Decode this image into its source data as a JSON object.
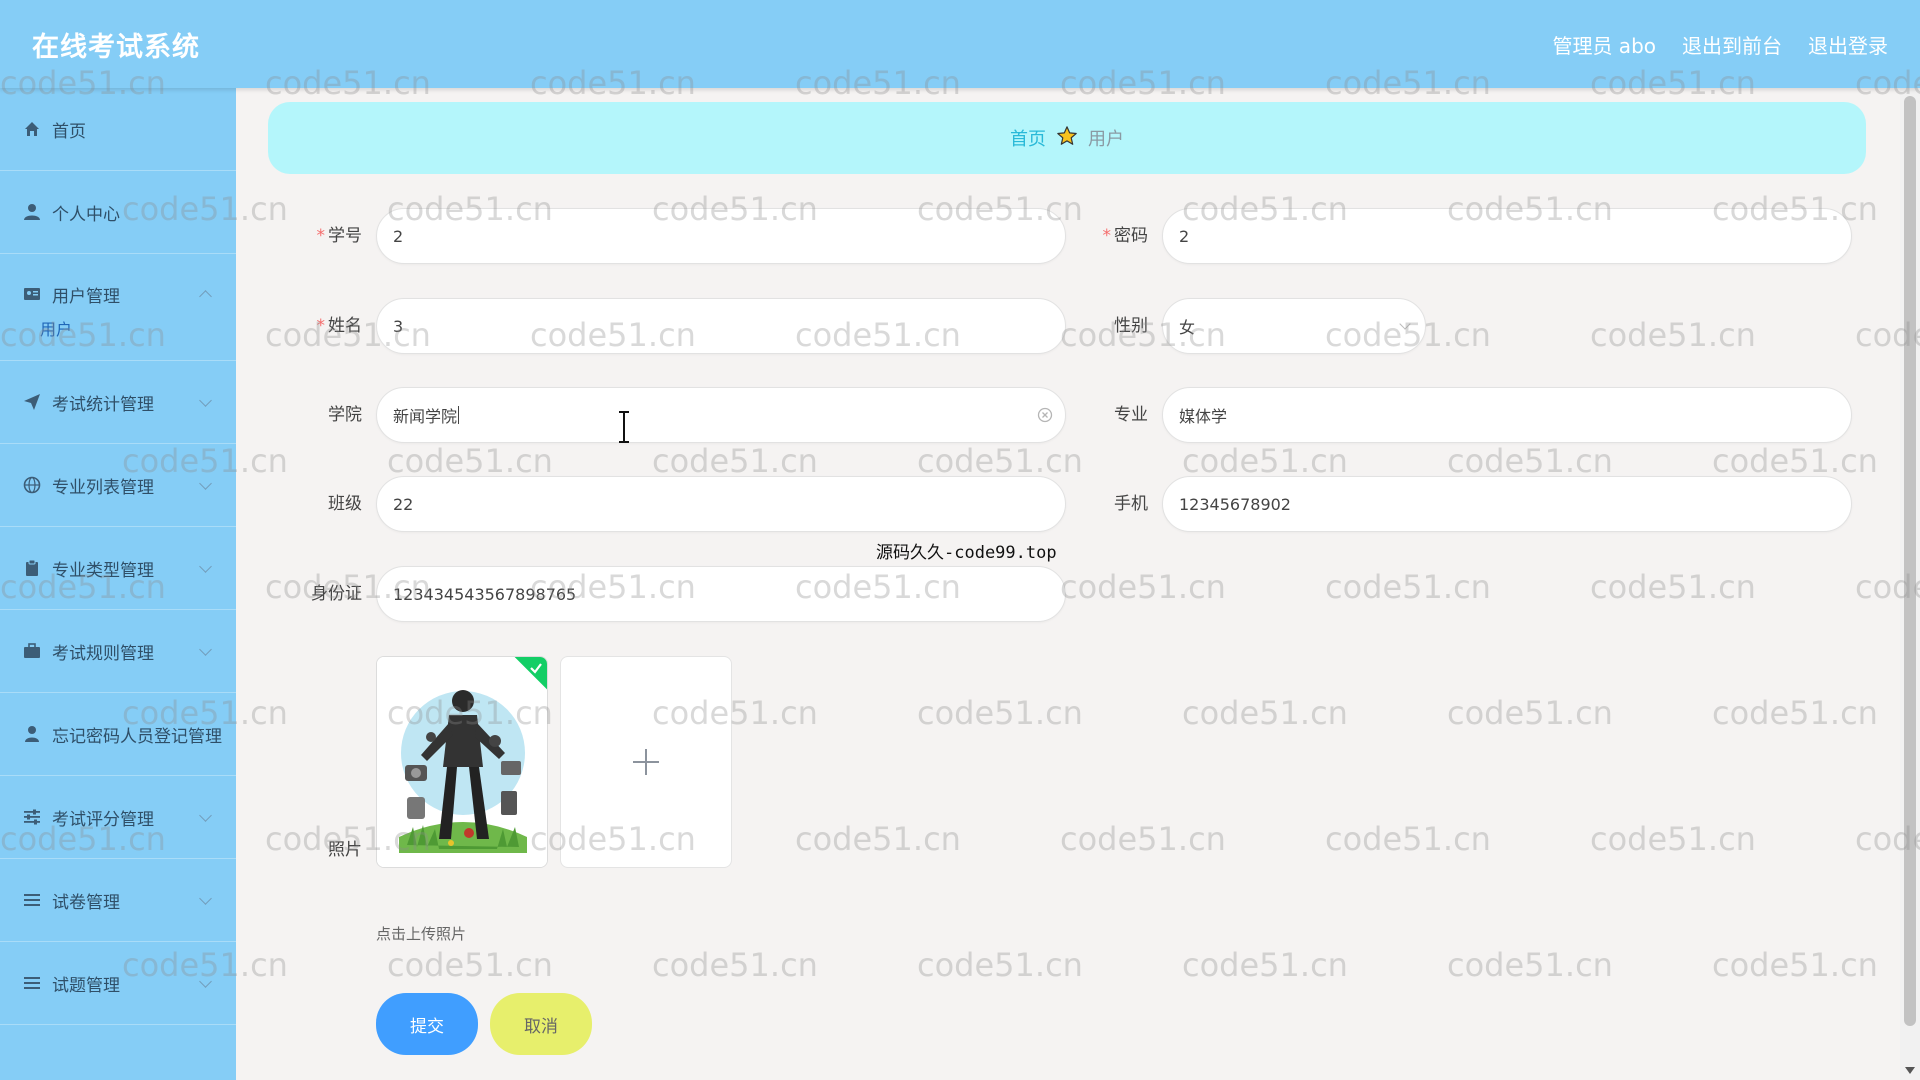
{
  "header": {
    "title": "在线考试系统",
    "user_label": "管理员 abo",
    "front_label": "退出到前台",
    "logout_label": "退出登录"
  },
  "sidebar": {
    "items": [
      {
        "label": "首页",
        "icon": "home-icon",
        "has_arrow": false
      },
      {
        "label": "个人中心",
        "icon": "user-icon",
        "has_arrow": false
      },
      {
        "label": "用户管理",
        "icon": "id-card-icon",
        "has_arrow": true,
        "expanded": true,
        "children": [
          "用户"
        ]
      },
      {
        "label": "考试统计管理",
        "icon": "send-icon",
        "has_arrow": true
      },
      {
        "label": "专业列表管理",
        "icon": "globe-icon",
        "has_arrow": true
      },
      {
        "label": "专业类型管理",
        "icon": "clipboard-icon",
        "has_arrow": true
      },
      {
        "label": "考试规则管理",
        "icon": "briefcase-icon",
        "has_arrow": true
      },
      {
        "label": "忘记密码人员登记管理",
        "icon": "person-icon",
        "has_arrow": false
      },
      {
        "label": "考试评分管理",
        "icon": "sliders-icon",
        "has_arrow": true
      },
      {
        "label": "试卷管理",
        "icon": "list-icon",
        "has_arrow": true
      },
      {
        "label": "试题管理",
        "icon": "list-icon",
        "has_arrow": true
      }
    ]
  },
  "breadcrumb": {
    "home": "首页",
    "current": "用户"
  },
  "form": {
    "student_id": {
      "label": "学号",
      "value": "2",
      "required": true
    },
    "password": {
      "label": "密码",
      "value": "2",
      "required": true
    },
    "name": {
      "label": "姓名",
      "value": "3",
      "required": true
    },
    "gender": {
      "label": "性别",
      "value": "女"
    },
    "college": {
      "label": "学院",
      "value": "新闻学院"
    },
    "major": {
      "label": "专业",
      "value": "媒体学"
    },
    "class": {
      "label": "班级",
      "value": "22"
    },
    "phone": {
      "label": "手机",
      "value": "12345678902"
    },
    "id_card": {
      "label": "身份证",
      "value": "123434543567898765"
    },
    "photo": {
      "label": "照片",
      "hint": "点击上传照片",
      "uploaded": true
    }
  },
  "buttons": {
    "submit": "提交",
    "cancel": "取消"
  },
  "overlay_text": "源码久久-code99.top",
  "watermark": "code51.cn",
  "colors": {
    "header_bg": "#85cdf6",
    "breadcrumb_bg": "#b4f6fb",
    "submit_bg": "#409eff",
    "cancel_bg": "#e7ef6c",
    "required": "#f56c6c"
  }
}
